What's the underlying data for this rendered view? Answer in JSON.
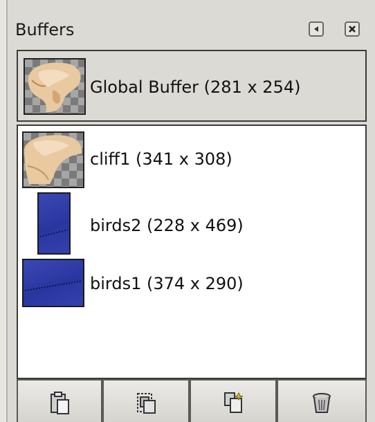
{
  "panel": {
    "title": "Buffers",
    "header_icons": [
      "dock-menu-arrow-icon",
      "close-icon"
    ]
  },
  "global_buffer": {
    "label": "Global Buffer (281 x 254)",
    "thumbnail": "cliff-photo-thumbnail"
  },
  "buffers": [
    {
      "label": "cliff1 (341 x 308)",
      "thumbnail": "cliff-photo-thumbnail"
    },
    {
      "label": "birds2 (228 x 469)",
      "thumbnail": "birds-blue-thumbnail"
    },
    {
      "label": "birds1 (374 x 290)",
      "thumbnail": "birds-blue-thumbnail"
    }
  ],
  "toolbar": {
    "buttons": [
      {
        "name": "paste-buffer-button",
        "icon": "clipboard-paste-icon"
      },
      {
        "name": "paste-into-button",
        "icon": "paste-into-selection-icon"
      },
      {
        "name": "paste-as-new-button",
        "icon": "paste-as-new-image-icon"
      },
      {
        "name": "delete-buffer-button",
        "icon": "trash-icon"
      }
    ]
  },
  "colors": {
    "background": "#dcdad5",
    "list_background": "#ffffff",
    "thumbnail_blue": "#2a36a0"
  }
}
